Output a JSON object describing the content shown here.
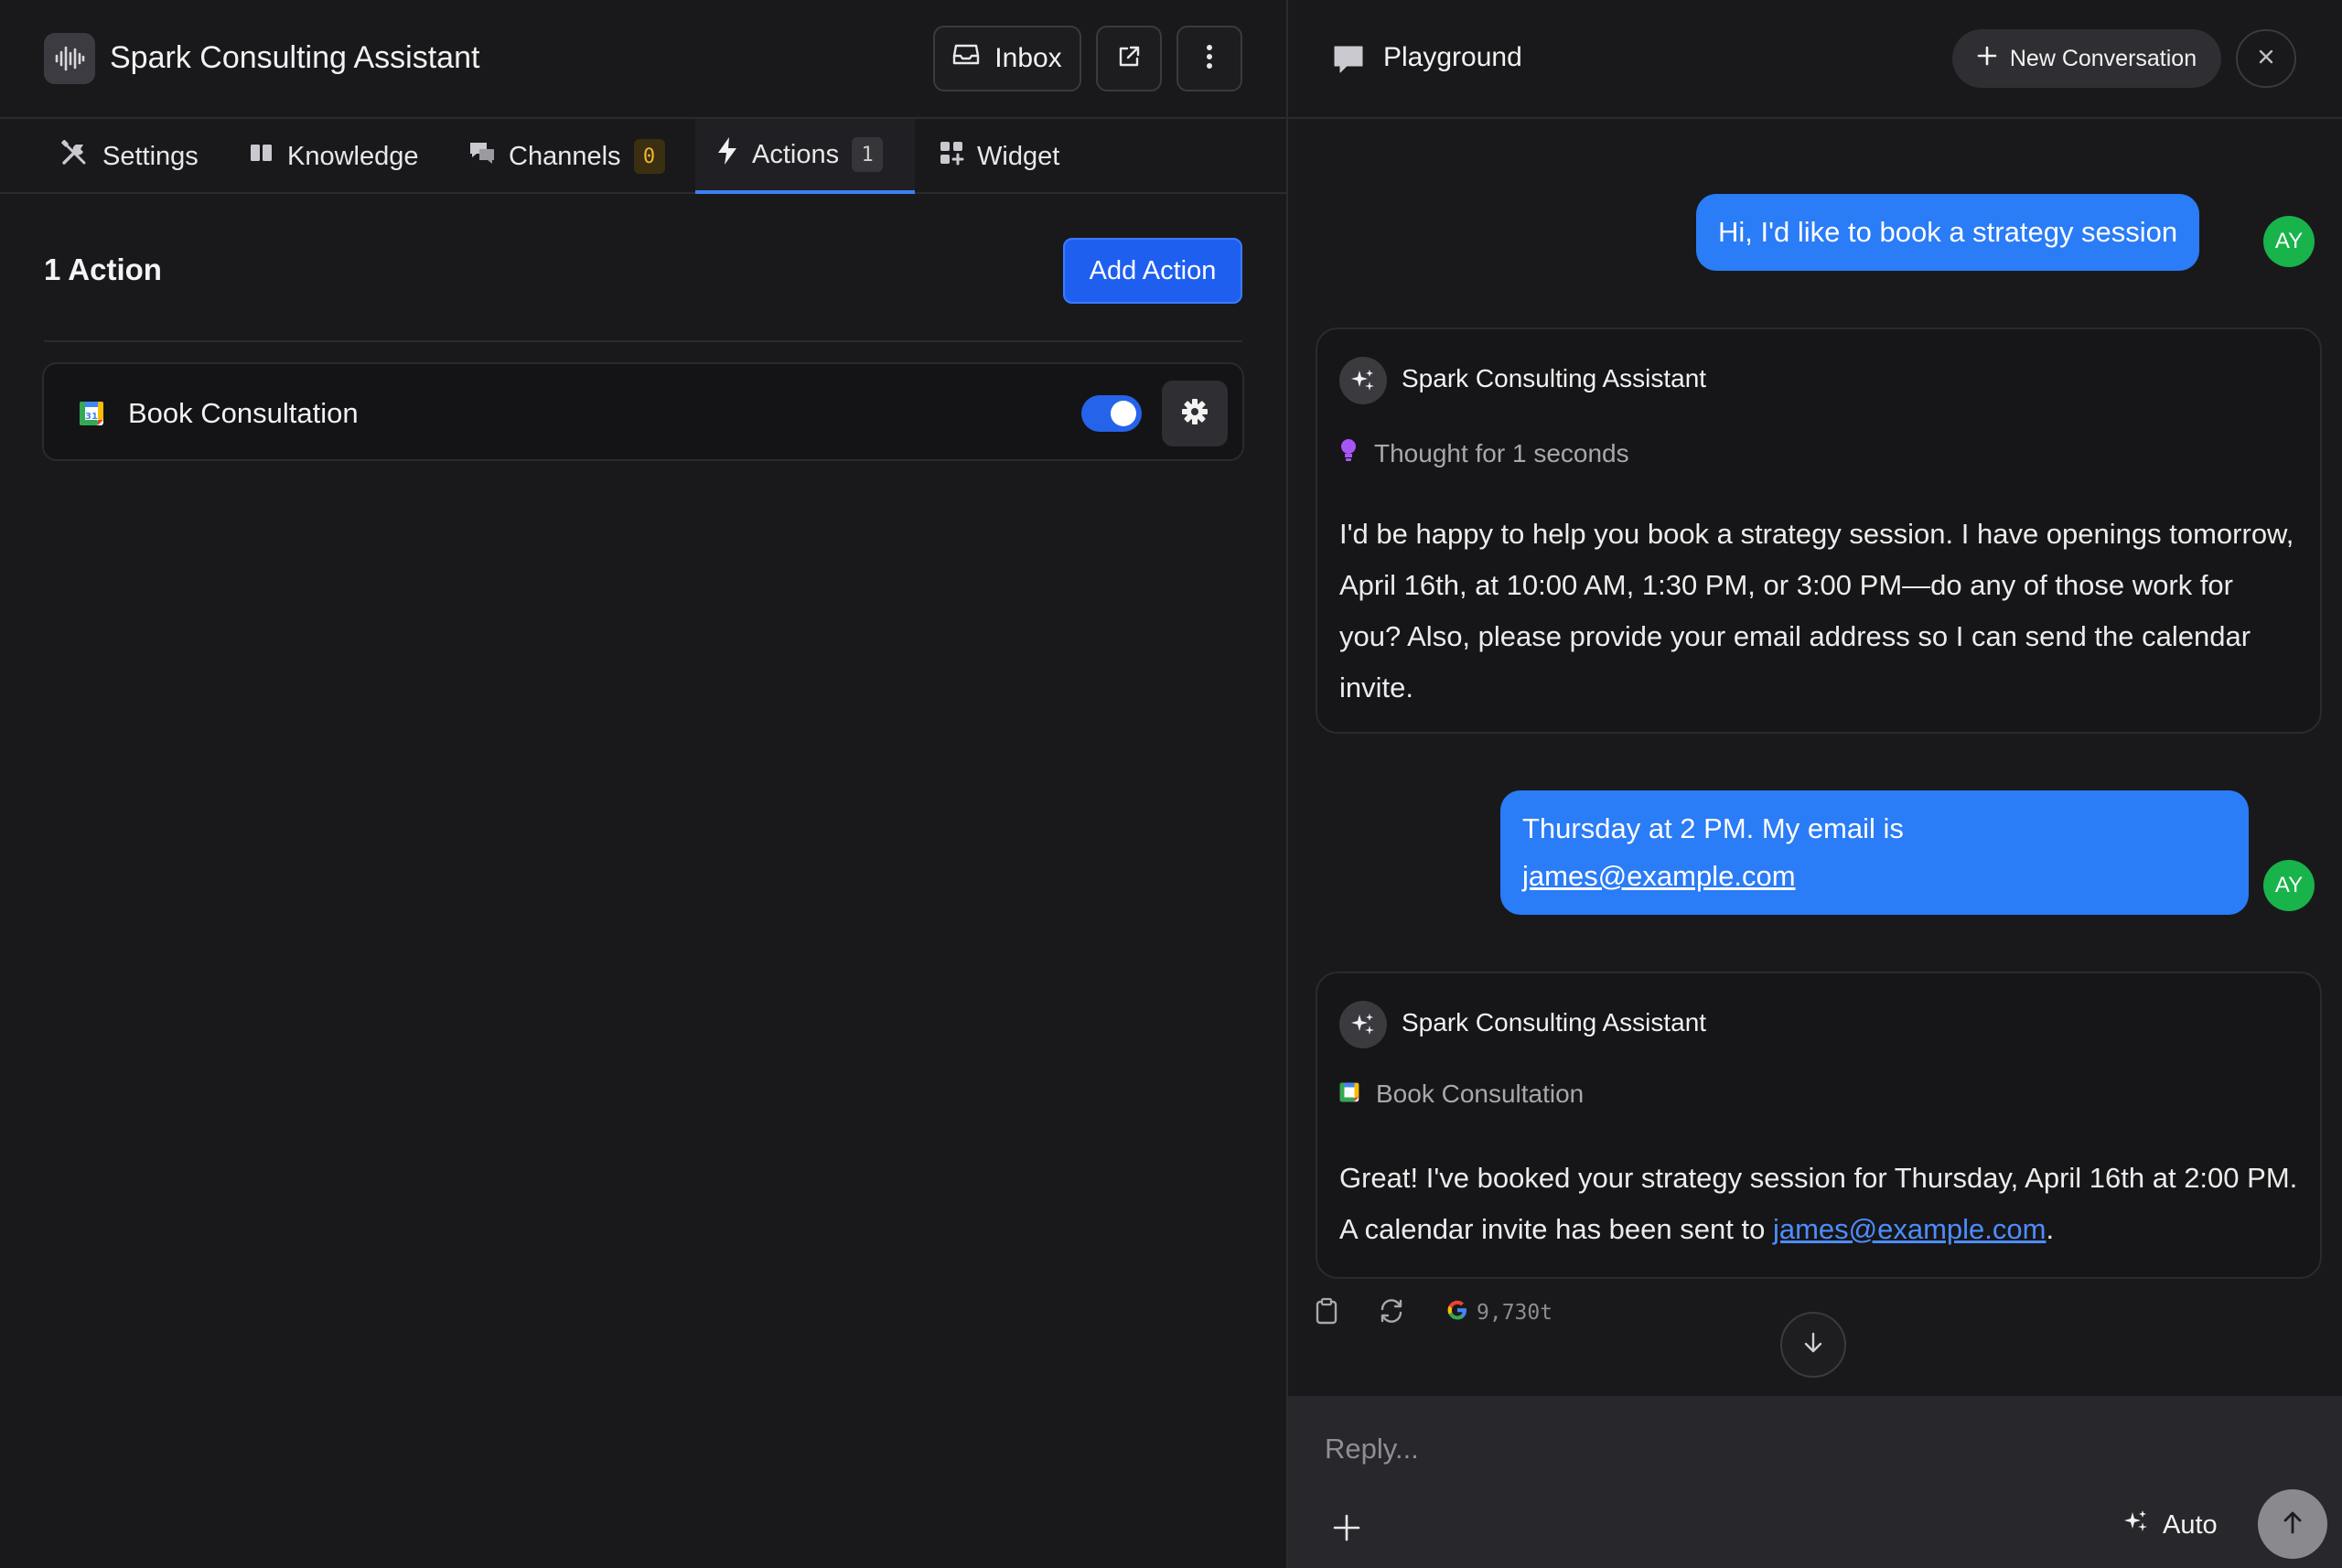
{
  "app": {
    "title": "Spark Consulting Assistant",
    "icon": "audio-waveform-icon"
  },
  "header": {
    "inbox_label": "Inbox"
  },
  "tabs": [
    {
      "label": "Settings",
      "icon": "tools-icon"
    },
    {
      "label": "Knowledge",
      "icon": "book-icon"
    },
    {
      "label": "Channels",
      "icon": "chat-bubbles-icon",
      "badge": "0"
    },
    {
      "label": "Actions",
      "icon": "lightning-icon",
      "badge": "1",
      "active": true
    },
    {
      "label": "Widget",
      "icon": "grid-icon"
    }
  ],
  "actions": {
    "count_title": "1 Action",
    "add_label": "Add Action",
    "items": [
      {
        "name": "Book Consultation",
        "icon": "google-calendar-icon",
        "enabled": true
      }
    ]
  },
  "playground": {
    "title": "Playground",
    "new_conversation_label": "New Conversation"
  },
  "chat": {
    "user_initials": "AY",
    "bot_name": "Spark Consulting Assistant",
    "messages": [
      {
        "role": "user",
        "text": "Hi, I'd like to book a strategy session"
      },
      {
        "role": "assistant",
        "meta": "Thought for 1 seconds",
        "text": "I'd be happy to help you book a strategy session. I have openings tomorrow, April 16th, at 10:00 AM, 1:30 PM, or 3:00 PM—do any of those work for you? Also, please provide your email address so I can send the calendar invite."
      },
      {
        "role": "user",
        "text_prefix": "Thursday at 2 PM. My email is",
        "link": "james@example.com"
      },
      {
        "role": "assistant",
        "meta": "Book Consultation",
        "text_prefix": "Great! I've booked your strategy session for Thursday, April 16th at 2:00 PM. A calendar invite has been sent to",
        "link": "james@example.com",
        "text_suffix": "."
      }
    ],
    "token_count": "9,730t"
  },
  "composer": {
    "placeholder": "Reply...",
    "mode_label": "Auto"
  },
  "colors": {
    "accent": "#2a7cf7",
    "avatar": "#18b34b",
    "badge_warn": "#f2b531",
    "thought_icon": "#a855f7"
  }
}
